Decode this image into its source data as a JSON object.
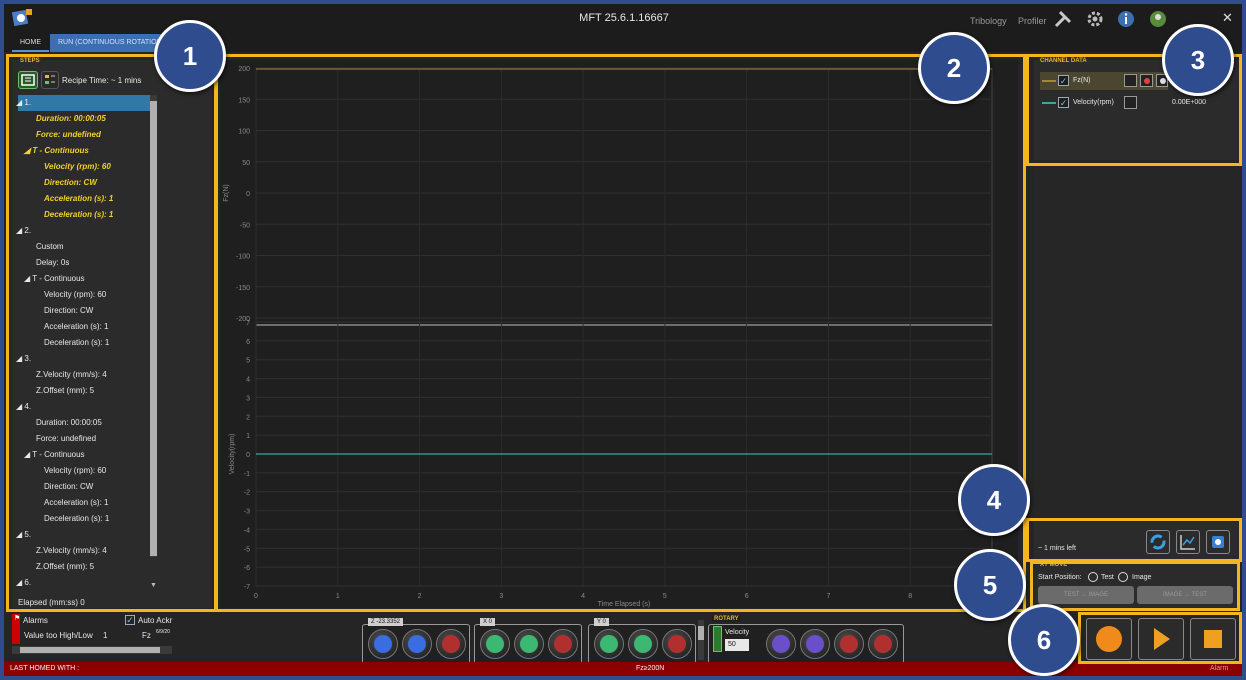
{
  "window": {
    "title": "MFT 25.6.1.16667",
    "close_glyph": "✕"
  },
  "topnav": {
    "tribology": "Tribology",
    "profiler": "Profiler"
  },
  "tabs": {
    "home": "HOME",
    "run": "RUN (CONTINUOUS ROTATION/XY"
  },
  "steps": {
    "group_label": "STEPS",
    "recipe_time": "Recipe Time:  ~ 1 mins",
    "elapsed": "Elapsed (mm:ss)   0",
    "rows": [
      "◢ 1.",
      "Duration: 00:00:05",
      "Force: undefined",
      "◢ T - Continuous",
      "Velocity (rpm): 60",
      "Direction: CW",
      "Acceleration (s): 1",
      "Deceleration (s): 1",
      "◢ 2.",
      "Custom",
      "Delay: 0s",
      "◢ T - Continuous",
      "Velocity (rpm): 60",
      "Direction: CW",
      "Acceleration (s): 1",
      "Deceleration (s): 1",
      "◢ 3.",
      "Z.Velocity (mm/s): 4",
      "Z.Offset (mm): 5",
      "◢ 4.",
      "Duration: 00:00:05",
      "Force: undefined",
      "◢ T - Continuous",
      "Velocity (rpm): 60",
      "Direction: CW",
      "Acceleration (s): 1",
      "Deceleration (s): 1",
      "◢ 5.",
      "Z.Velocity (mm/s): 4",
      "Z.Offset (mm): 5",
      "◢ 6."
    ]
  },
  "chart_data": {
    "type": "line",
    "xlabel": "Time Elapsed (s)",
    "x_ticks": [
      "0",
      "1",
      "2",
      "3",
      "4",
      "5",
      "6",
      "7",
      "8"
    ],
    "xlim": [
      0,
      9
    ],
    "top_axis": {
      "ylabel": "Fz(N)",
      "ticks": [
        "200",
        "150",
        "100",
        "50",
        "0",
        "-50",
        "-100",
        "-150",
        "-200"
      ],
      "ylim": [
        -200,
        200
      ]
    },
    "bottom_axis": {
      "ylabel": "Velocity(rpm)",
      "ticks": [
        "7",
        "6",
        "5",
        "4",
        "3",
        "2",
        "1",
        "0",
        "-1",
        "-2",
        "-3",
        "-4",
        "-5",
        "-6",
        "-7"
      ],
      "ylim": [
        -7,
        7
      ]
    },
    "series": [
      {
        "name": "Fz(N)",
        "color": "#a08a2a",
        "points": []
      },
      {
        "name": "Velocity(rpm)",
        "color": "#3aa3a8",
        "value": 0
      }
    ],
    "grid": true
  },
  "channels": {
    "group_label": "CHANNEL DATA",
    "items": [
      {
        "name": "Fz(N)",
        "value": ""
      },
      {
        "name": "Velocity(rpm)",
        "value": "0.00E+000"
      }
    ]
  },
  "run_status": {
    "time_left": "~ 1     mins left"
  },
  "xy_move": {
    "group_label": "XY MOVE",
    "start_position": "Start Position:",
    "option_test": "Test",
    "option_image": "Image",
    "btn1": "TEST → IMAGE",
    "btn2": "IMAGE → TEST"
  },
  "alarms": {
    "title": "Alarms",
    "auto_ack": "Auto Ackr",
    "row_text": "Value too High/Low",
    "row_count": "1",
    "row_channel": "Fz",
    "row_date": "6/9/20"
  },
  "axis_controls": {
    "z_label": "Z   -23.3352",
    "x_label": "X   0",
    "y_label": "Y   0",
    "rotary_label": "ROTARY",
    "velocity_label": "Velocity",
    "velocity_value": "50"
  },
  "status": {
    "last_homed": "LAST HOMED WITH :",
    "force": "Fz≥200N",
    "right": "Alarm"
  },
  "badges": [
    "1",
    "2",
    "3",
    "4",
    "5",
    "6"
  ]
}
